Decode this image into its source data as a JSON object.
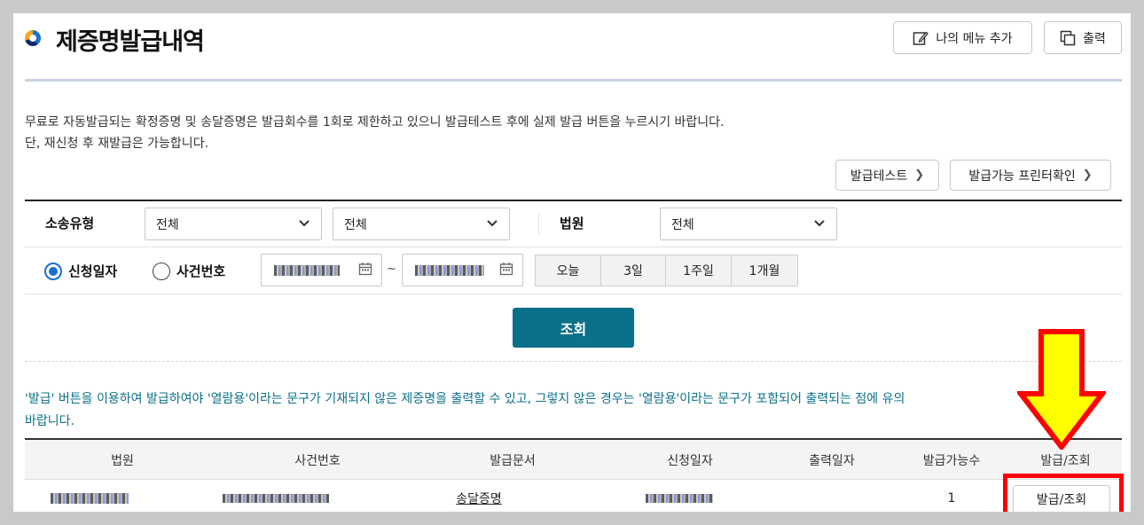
{
  "header": {
    "title": "제증명발급내역",
    "add_menu_label": "나의 메뉴 추가",
    "print_label": "출력"
  },
  "notice": {
    "line1": "무료로 자동발급되는 확정증명 및 송달증명은 발급회수를 1회로 제한하고 있으니 발급테스트 후에 실제 발급 버튼을 누르시기 바랍니다.",
    "line2": "단, 재신청 후 재발급은 가능합니다."
  },
  "actions": {
    "test_label": "발급테스트",
    "printer_label": "발급가능 프린터확인"
  },
  "filters": {
    "case_type_label": "소송유형",
    "case_type_value_1": "전체",
    "case_type_value_2": "전체",
    "court_label": "법원",
    "court_value": "전체",
    "radio_date_label": "신청일자",
    "radio_case_label": "사건번호",
    "date_separator": "~",
    "ranges": [
      "오늘",
      "3일",
      "1주일",
      "1개월"
    ],
    "search_label": "조회"
  },
  "info": {
    "text": "'발급' 버튼을 이용하여 발급하여야 '열람용'이라는 문구가 기재되지 않은 제증명을 출력할 수 있고, 그렇지 않은 경우는 '열람용'이라는 문구가 포함되어 출력되는 점에 유의",
    "text2": "바랍니다."
  },
  "table": {
    "headers": [
      "법원",
      "사건번호",
      "발급문서",
      "신청일자",
      "출력일자",
      "발급가능수",
      "발급/조회"
    ],
    "row": {
      "document": "송달증명",
      "available": "1",
      "action_label": "발급/조회"
    }
  },
  "colors": {
    "primary": "#0b7089",
    "highlight": "#ff0000",
    "arrow": "#ffff00"
  }
}
